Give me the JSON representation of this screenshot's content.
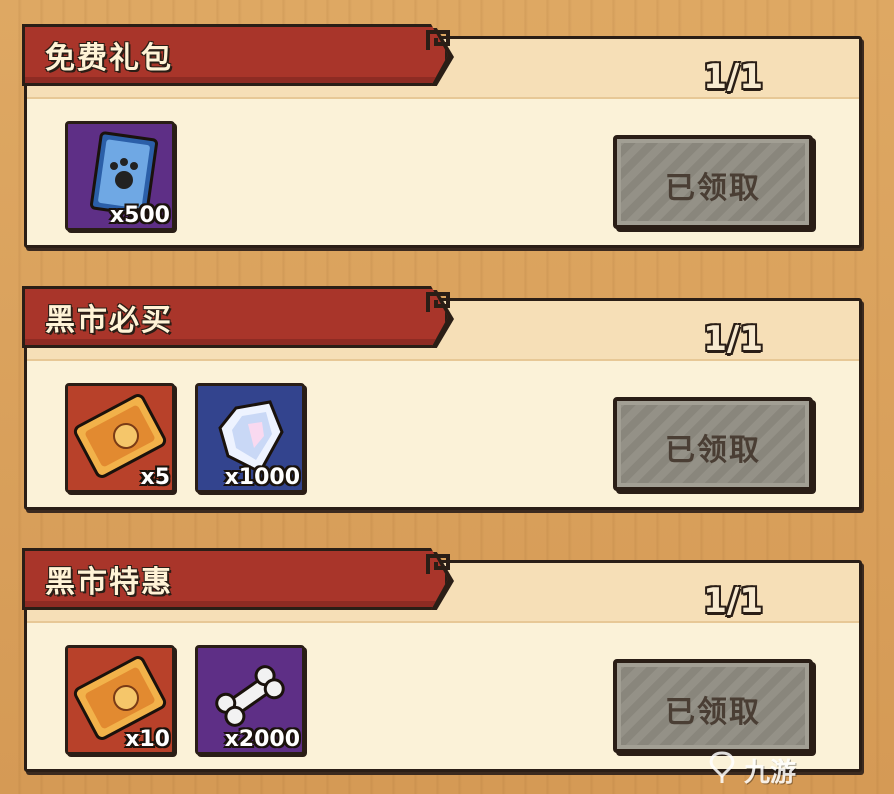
{
  "panels": [
    {
      "title": "免费礼包",
      "counter": "1/1",
      "button_label": "已领取",
      "items": [
        {
          "icon": "paw-card-icon",
          "quantity": "x500"
        }
      ]
    },
    {
      "title": "黑市必买",
      "counter": "1/1",
      "button_label": "已领取",
      "items": [
        {
          "icon": "ticket-icon",
          "quantity": "x5"
        },
        {
          "icon": "crystal-icon",
          "quantity": "x1000"
        }
      ]
    },
    {
      "title": "黑市特惠",
      "counter": "1/1",
      "button_label": "已领取",
      "items": [
        {
          "icon": "ticket-icon",
          "quantity": "x10"
        },
        {
          "icon": "bone-icon",
          "quantity": "x2000"
        }
      ]
    }
  ],
  "watermark": {
    "text": "九游"
  },
  "colors": {
    "ribbon": "#a9352a",
    "panel_bg": "#fbf2d8",
    "button_disabled": "#8d8a80",
    "background": "#d9a05a"
  }
}
